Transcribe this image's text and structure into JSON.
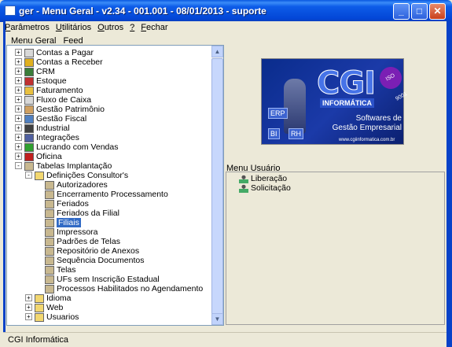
{
  "window": {
    "title": "ger - Menu Geral - v2.34 - 001.001 - 08/01/2013 - suporte",
    "buttons": [
      "minimize",
      "maximize",
      "close"
    ]
  },
  "menubar": [
    {
      "label": "Parâmetros",
      "accel": "P"
    },
    {
      "label": "Utilitários",
      "accel": "U"
    },
    {
      "label": "Outros",
      "accel": "O"
    },
    {
      "label": "?",
      "accel": "?"
    },
    {
      "label": "Fechar",
      "accel": "F"
    }
  ],
  "tabs": [
    "Menu Geral",
    "Feed"
  ],
  "tree": [
    {
      "label": "Contas a Pagar",
      "level": 0,
      "expander": "+",
      "icon": "report-icon"
    },
    {
      "label": "Contas a Receber",
      "level": 0,
      "expander": "+",
      "icon": "money-icon"
    },
    {
      "label": "CRM",
      "level": 0,
      "expander": "+",
      "icon": "crm-icon"
    },
    {
      "label": "Estoque",
      "level": 0,
      "expander": "+",
      "icon": "stock-icon"
    },
    {
      "label": "Faturamento",
      "level": 0,
      "expander": "+",
      "icon": "invoice-icon"
    },
    {
      "label": "Fluxo de Caixa",
      "level": 0,
      "expander": "+",
      "icon": "report-icon"
    },
    {
      "label": "Gestão Patrimônio",
      "level": 0,
      "expander": "+",
      "icon": "asset-icon"
    },
    {
      "label": "Gestão Fiscal",
      "level": 0,
      "expander": "+",
      "icon": "tax-icon"
    },
    {
      "label": "Industrial",
      "level": 0,
      "expander": "+",
      "icon": "gear-icon"
    },
    {
      "label": "Integrações",
      "level": 0,
      "expander": "+",
      "icon": "integration-icon"
    },
    {
      "label": "Lucrando com Vendas",
      "level": 0,
      "expander": "+",
      "icon": "sales-icon"
    },
    {
      "label": "Oficina",
      "level": 0,
      "expander": "+",
      "icon": "car-icon"
    },
    {
      "label": "Tabelas Implantação",
      "level": 0,
      "expander": "-",
      "icon": "people-icon"
    },
    {
      "label": "Definições Consultor's",
      "level": 1,
      "expander": "-",
      "icon": "folder-open-icon"
    },
    {
      "label": "Autorizadores",
      "level": 2,
      "expander": "",
      "icon": "people-icon"
    },
    {
      "label": "Encerramento Processamento",
      "level": 2,
      "expander": "",
      "icon": "people-icon"
    },
    {
      "label": "Feriados",
      "level": 2,
      "expander": "",
      "icon": "people-icon"
    },
    {
      "label": "Feriados da Filial",
      "level": 2,
      "expander": "",
      "icon": "people-icon"
    },
    {
      "label": "Filiais",
      "level": 2,
      "expander": "",
      "icon": "people-icon",
      "selected": true
    },
    {
      "label": "Impressora",
      "level": 2,
      "expander": "",
      "icon": "people-icon"
    },
    {
      "label": "Padrões de Telas",
      "level": 2,
      "expander": "",
      "icon": "people-icon"
    },
    {
      "label": "Repositório de Anexos",
      "level": 2,
      "expander": "",
      "icon": "people-icon"
    },
    {
      "label": "Sequência Documentos",
      "level": 2,
      "expander": "",
      "icon": "people-icon"
    },
    {
      "label": "Telas",
      "level": 2,
      "expander": "",
      "icon": "people-icon"
    },
    {
      "label": "UFs sem Inscrição Estadual",
      "level": 2,
      "expander": "",
      "icon": "people-icon"
    },
    {
      "label": "Processos Habilitados no Agendamento",
      "level": 2,
      "expander": "",
      "icon": "people-icon"
    },
    {
      "label": "Idioma",
      "level": 1,
      "expander": "+",
      "icon": "folder-icon"
    },
    {
      "label": "Web",
      "level": 1,
      "expander": "+",
      "icon": "folder-icon"
    },
    {
      "label": "Usuarios",
      "level": 1,
      "expander": "+",
      "icon": "folder-icon"
    }
  ],
  "banner": {
    "logo": "CGI",
    "iso": "ISO 9001",
    "informatica": "INFORMÁTICA",
    "erp": "ERP",
    "bi": "BI",
    "rh": "RH",
    "line1": "Softwares de",
    "line2": "Gestão Empresarial",
    "url": "www.cgiinformatica.com.br"
  },
  "menu_usuario": {
    "title": "Menu Usuário",
    "items": [
      "Liberação",
      "Solicitação"
    ]
  },
  "status": "CGI Informática",
  "colors": {
    "titlebar": "#0346d6",
    "selection": "#316ac5",
    "window_bg": "#ece9d8"
  }
}
